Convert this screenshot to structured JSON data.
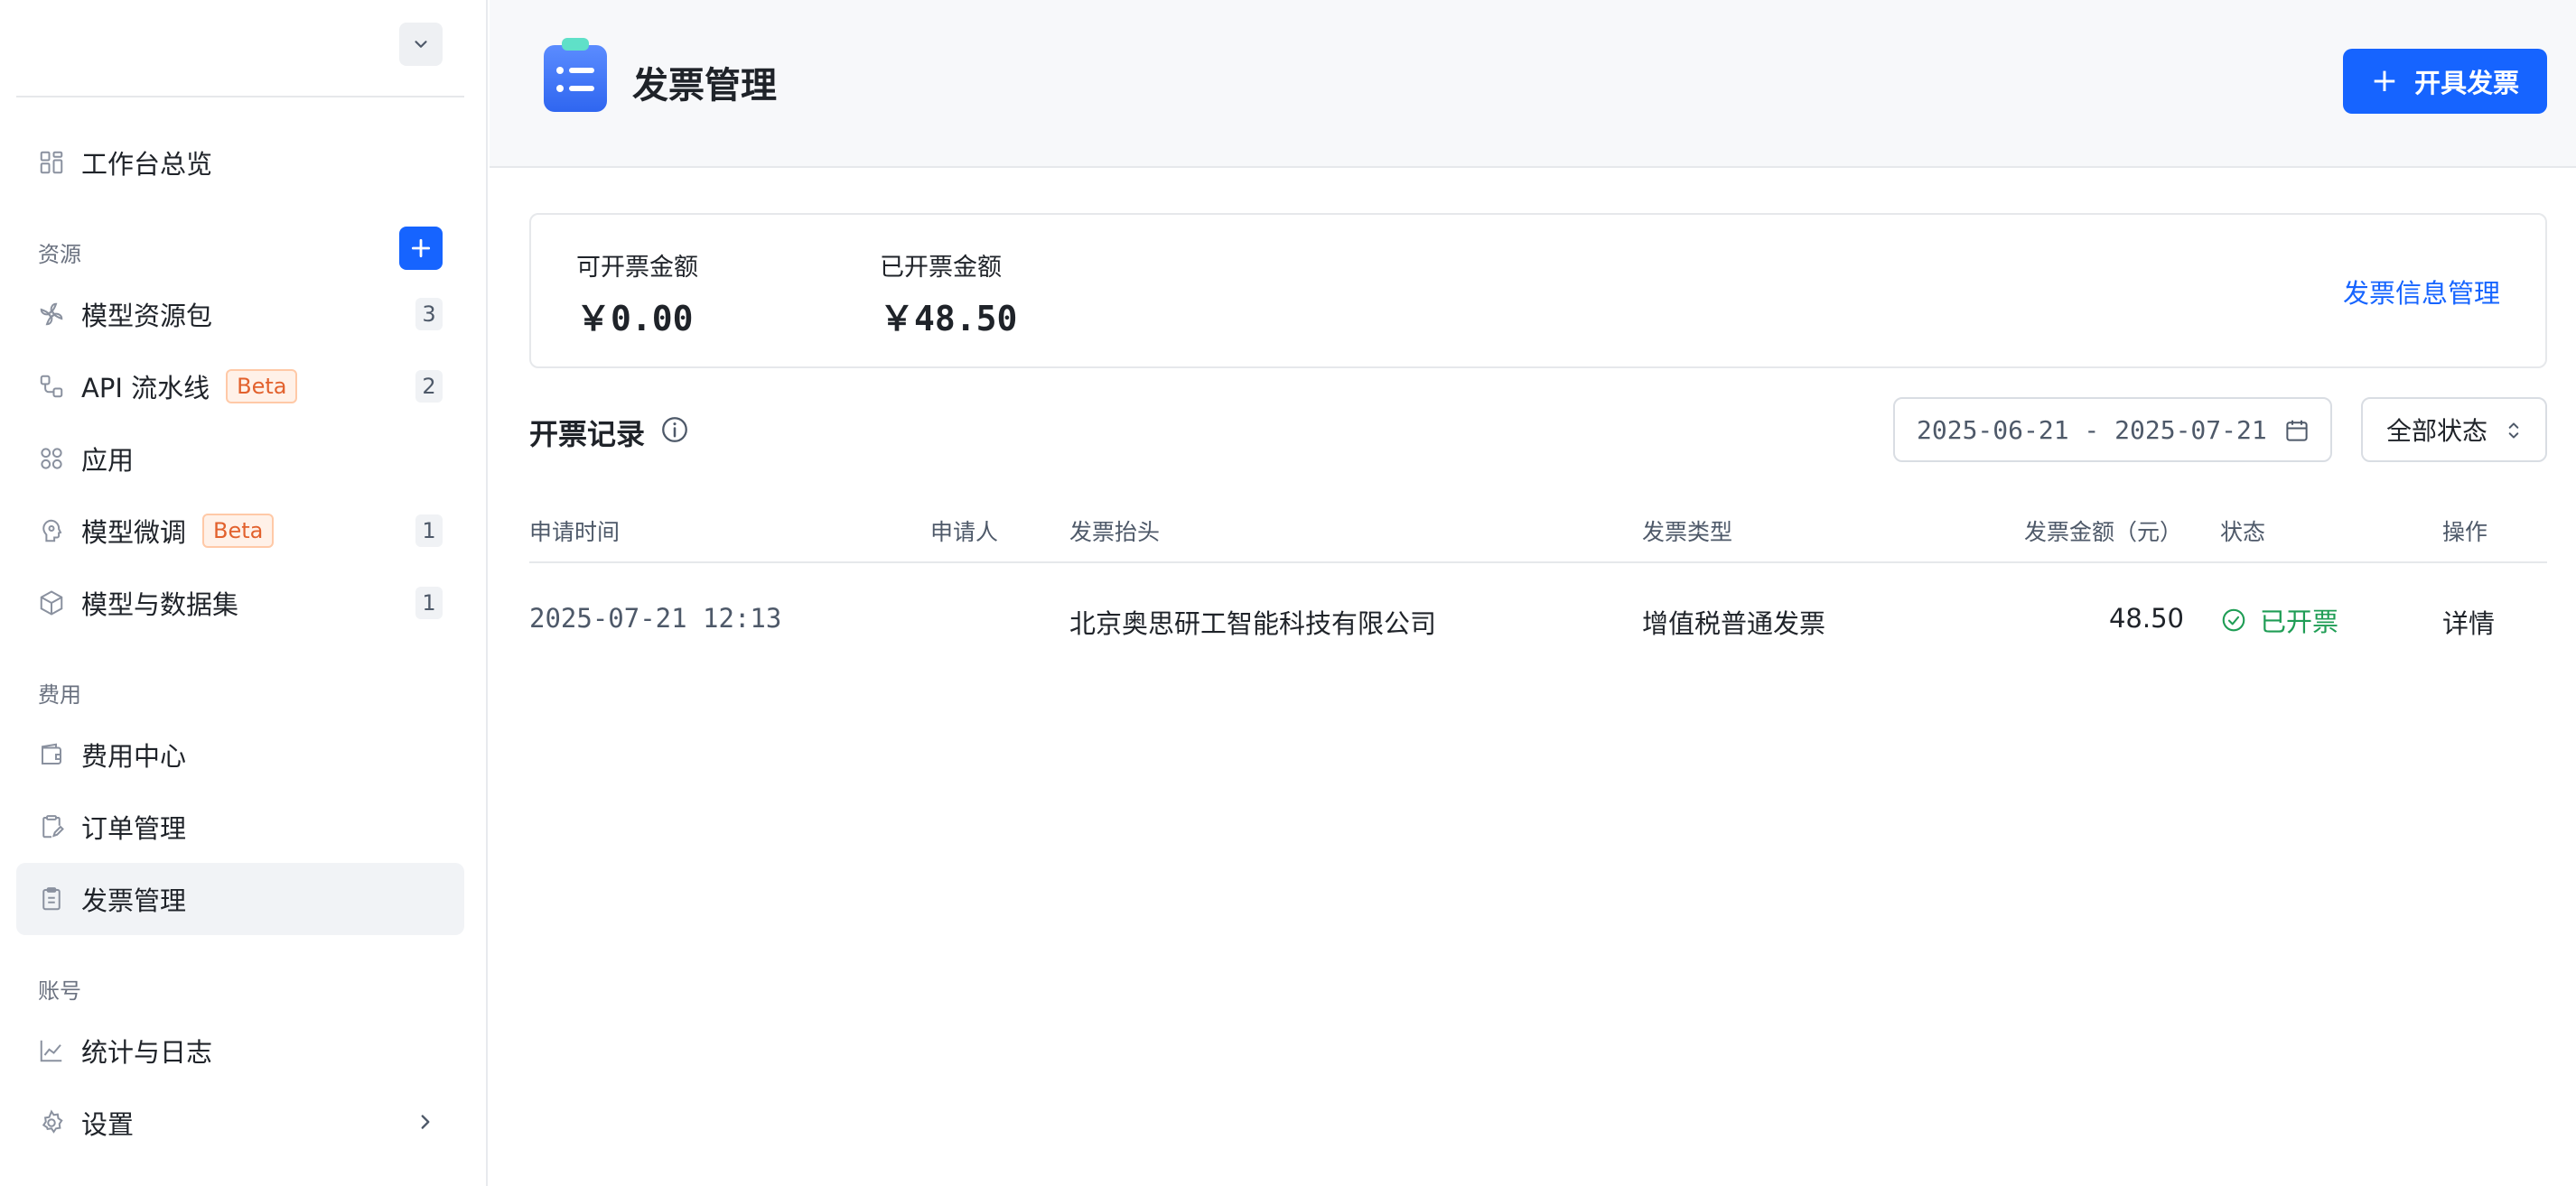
{
  "sidebar": {
    "items": [
      {
        "label": "工作台总览"
      },
      {
        "label": "模型资源包",
        "count": "3"
      },
      {
        "label": "API 流水线",
        "badge": "Beta",
        "count": "2"
      },
      {
        "label": "应用"
      },
      {
        "label": "模型微调",
        "badge": "Beta",
        "count": "1"
      },
      {
        "label": "模型与数据集",
        "count": "1"
      },
      {
        "label": "费用中心"
      },
      {
        "label": "订单管理"
      },
      {
        "label": "发票管理",
        "active": true
      },
      {
        "label": "统计与日志"
      },
      {
        "label": "设置"
      }
    ],
    "sections": {
      "resources": "资源",
      "billing": "费用",
      "account": "账号"
    }
  },
  "header": {
    "title": "发票管理",
    "primary_button": "开具发票"
  },
  "summary": {
    "available_label": "可开票金额",
    "available_value": "￥0.00",
    "issued_label": "已开票金额",
    "issued_value": "￥48.50",
    "manage_link": "发票信息管理"
  },
  "records": {
    "title": "开票记录",
    "date_range": "2025-06-21 - 2025-07-21",
    "status_filter": "全部状态",
    "columns": [
      "申请时间",
      "申请人",
      "发票抬头",
      "发票类型",
      "发票金额（元）",
      "状态",
      "操作"
    ],
    "rows": [
      {
        "time": "2025-07-21 12:13",
        "applicant": "",
        "title": "北京奥思研工智能科技有限公司",
        "type": "增值税普通发票",
        "amount": "48.50",
        "status": "已开票",
        "action": "详情"
      }
    ]
  },
  "colors": {
    "primary": "#1664ff",
    "success": "#1f9d55",
    "beta": "#e2612d"
  }
}
